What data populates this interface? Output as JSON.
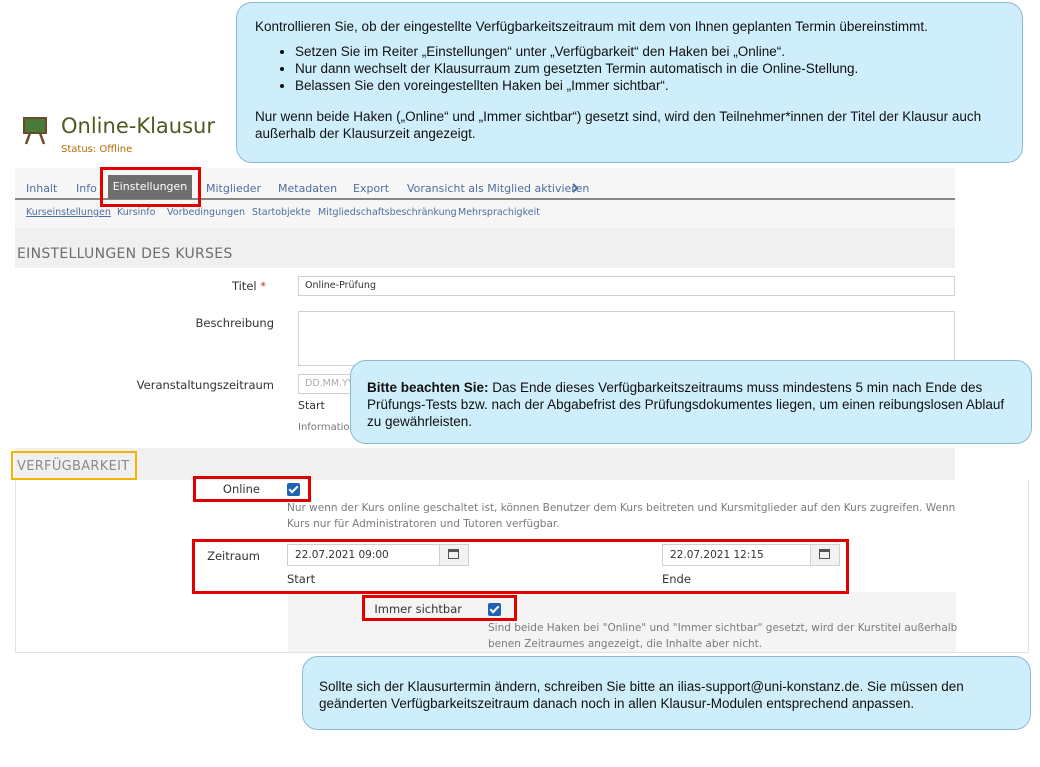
{
  "header": {
    "title": "Online-Klausur",
    "status": "Status: Offline"
  },
  "tabs": [
    {
      "label": "Inhalt"
    },
    {
      "label": "Info"
    },
    {
      "label": "Einstellungen"
    },
    {
      "label": "Mitglieder"
    },
    {
      "label": "Metadaten"
    },
    {
      "label": "Export"
    },
    {
      "label": "Voransicht als Mitglied aktivieren"
    }
  ],
  "subtabs": [
    {
      "label": "Kurseinstellungen"
    },
    {
      "label": "Kursinfo"
    },
    {
      "label": "Vorbedingungen"
    },
    {
      "label": "Startobjekte"
    },
    {
      "label": "Mitgliedschaftsbeschränkung"
    },
    {
      "label": "Mehrsprachigkeit"
    }
  ],
  "settings": {
    "section_title": "EINSTELLUNGEN DES KURSES",
    "title_label": "Titel",
    "required_mark": "*",
    "title_value": "Online-Prüfung",
    "description_label": "Beschreibung",
    "period_label": "Veranstaltungszeitraum",
    "period_placeholder": "DD.MM.YY",
    "period_start": "Start",
    "period_info": "Information"
  },
  "availability": {
    "section_title": "VERFÜGBARKEIT",
    "online_label": "Online",
    "online_help_1": "Nur wenn der Kurs online geschaltet ist, können Benutzer dem Kurs beitreten und Kursmitglieder auf den Kurs zugreifen. Wenn",
    "online_help_2": "Kurs nur für Administratoren und Tutoren verfügbar.",
    "period_label": "Zeitraum",
    "start_value": "22.07.2021 09:00",
    "start_label": "Start",
    "end_value": "22.07.2021 12:15",
    "end_label": "Ende",
    "visible_label": "Immer sichtbar",
    "visible_help_1": "Sind beide Haken bei \"Online\" und \"Immer sichtbar\" gesetzt, wird der Kurstitel außerhalb",
    "visible_help_2": "benen Zeitraumes angezeigt, die Inhalte aber nicht."
  },
  "callouts": {
    "top": {
      "intro": "Kontrollieren Sie, ob der eingestellte Verfügbarkeitszeitraum mit dem von Ihnen geplanten Termin übereinstimmt.",
      "bullets": [
        "Setzen Sie im Reiter „Einstellungen“ unter „Verfügbarkeit“ den Haken bei „Online“.",
        "Nur dann wechselt der Klausurraum zum gesetzten Termin automatisch in die   Online-Stellung.",
        "Belassen Sie den voreingestellten Haken bei „Immer sichtbar“."
      ],
      "outro": "Nur wenn beide Haken („Online“ und „Immer sichtbar“) gesetzt sind, wird den Teilnehmer*innen der Titel der Klausur auch außerhalb der Klausurzeit angezeigt."
    },
    "middle": {
      "bold": "Bitte beachten Sie:",
      "text": " Das Ende dieses Verfügbarkeitszeitraums muss mindestens 5 min nach Ende des Prüfungs-Tests bzw. nach der Abgabefrist des Prüfungsdokumentes liegen, um einen reibungslosen Ablauf zu gewährleisten."
    },
    "bottom": {
      "text": "Sollte sich der Klausurtermin ändern, schreiben Sie bitte an ilias-support@uni-konstanz.de. Sie müssen den geänderten Verfügbarkeitszeitraum danach noch in allen Klausur-Modulen entsprechend anpassen."
    }
  },
  "colors": {
    "highlight_red": "#e00000",
    "highlight_yellow": "#f2b400",
    "callout_bg": "#cfeefc",
    "checkbox": "#1f64b4"
  }
}
